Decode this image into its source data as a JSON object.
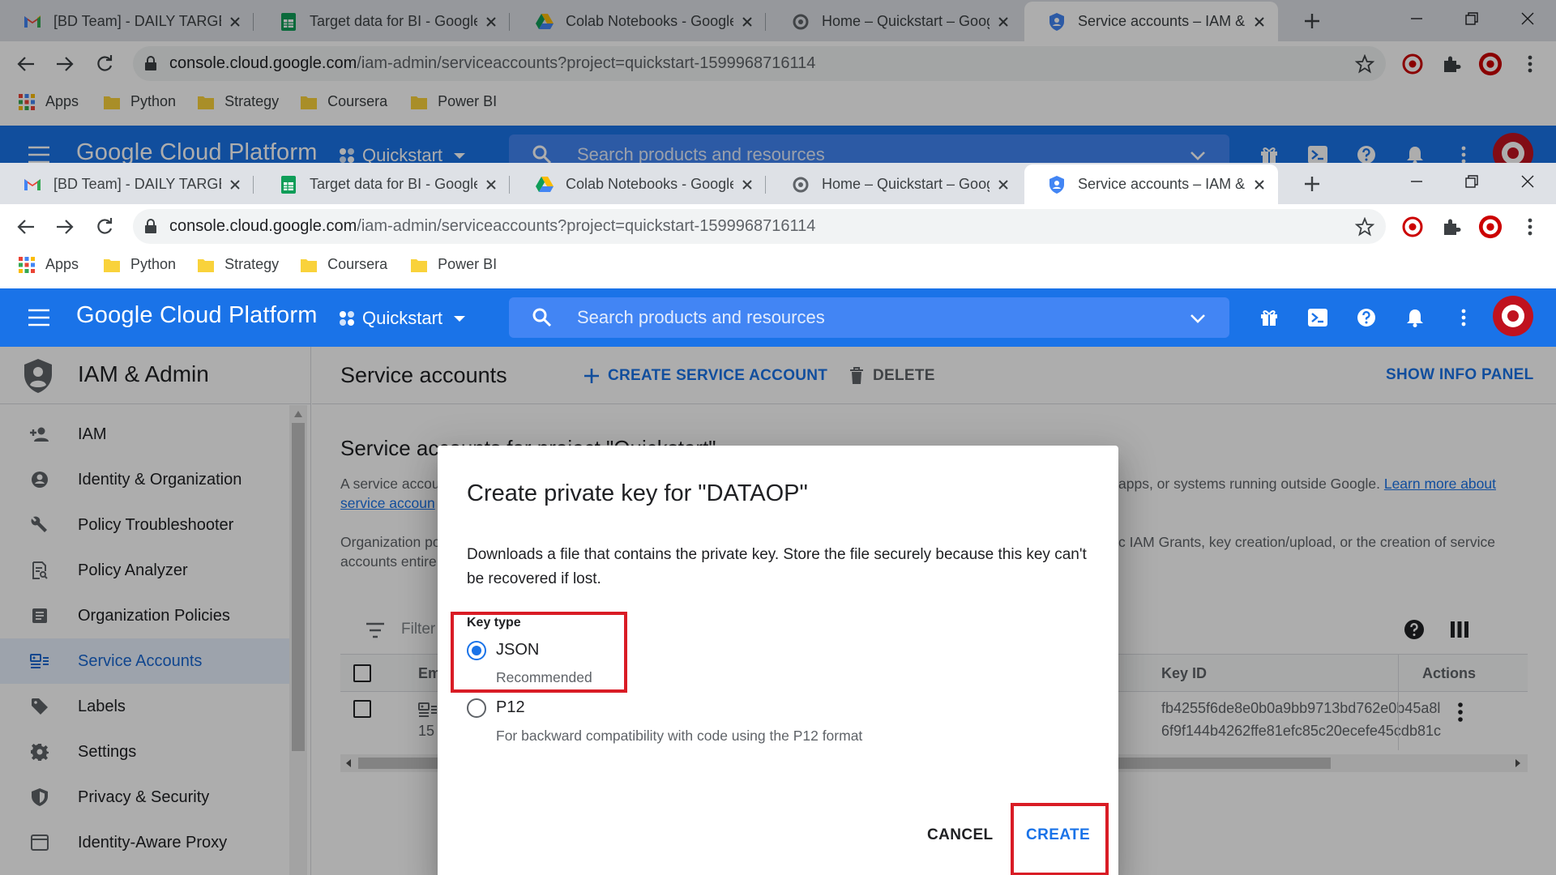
{
  "browser": {
    "tabs": [
      {
        "title": "[BD Team] - DAILY TARGET S",
        "favicon": "gmail-icon"
      },
      {
        "title": "Target data for BI - Google",
        "favicon": "sheets-icon"
      },
      {
        "title": "Colab Notebooks - Google",
        "favicon": "drive-icon"
      },
      {
        "title": "Home – Quickstart – Googl",
        "favicon": "chrome-page-icon"
      },
      {
        "title": "Service accounts – IAM & A",
        "favicon": "gcp-shield-icon"
      }
    ],
    "url_host": "console.cloud.google.com",
    "url_path": "/iam-admin/serviceaccounts?project=quickstart-1599968716114",
    "bookmarks": [
      {
        "label": "Apps",
        "icon": "apps-grid-icon"
      },
      {
        "label": "Python",
        "icon": "folder-icon"
      },
      {
        "label": "Strategy",
        "icon": "folder-icon"
      },
      {
        "label": "Coursera",
        "icon": "folder-icon"
      },
      {
        "label": "Power BI",
        "icon": "folder-icon"
      }
    ]
  },
  "gcp": {
    "title": "Google Cloud Platform",
    "project": "Quickstart",
    "search_placeholder": "Search products and resources",
    "brand_color": "#1a73e8"
  },
  "nav": {
    "title": "IAM & Admin",
    "items": [
      {
        "label": "IAM",
        "icon": "person-add-icon"
      },
      {
        "label": "Identity & Organization",
        "icon": "account-circle-icon"
      },
      {
        "label": "Policy Troubleshooter",
        "icon": "wrench-icon"
      },
      {
        "label": "Policy Analyzer",
        "icon": "policy-doc-icon"
      },
      {
        "label": "Organization Policies",
        "icon": "list-doc-icon"
      },
      {
        "label": "Service Accounts",
        "icon": "service-account-icon",
        "active": true
      },
      {
        "label": "Labels",
        "icon": "label-icon"
      },
      {
        "label": "Settings",
        "icon": "gear-icon"
      },
      {
        "label": "Privacy & Security",
        "icon": "shield-icon"
      },
      {
        "label": "Identity-Aware Proxy",
        "icon": "iap-icon"
      }
    ]
  },
  "main": {
    "title": "Service accounts",
    "create_label": "CREATE SERVICE ACCOUNT",
    "delete_label": "DELETE",
    "info_panel_label": "SHOW INFO PANEL",
    "section_title": "Service accounts for project \"Quickstart\"",
    "desc1_start": "A service accou",
    "desc1_end": "apps, or systems running outside Google.",
    "desc1_link": "Learn more about",
    "desc1_link2": "service accoun",
    "desc2_start": "Organization po",
    "desc2_end": "c IAM Grants, key creation/upload, or the creation of service",
    "desc2_line2": "accounts entire",
    "filter_placeholder": "Filter",
    "columns": {
      "email": "Em",
      "key_id": "Key ID",
      "actions": "Actions"
    },
    "row": {
      "email_fragment": "15",
      "key_id_1": "fb4255f6de8e0b0a9bb9713bd762e0b45a8l",
      "key_id_2": "6f9f144b4262ffe81efc85c20ecefe45cdb81c"
    }
  },
  "dialog": {
    "title": "Create private key for \"DATAOP\"",
    "body": "Downloads a file that contains the private key. Store the file securely because this key can't be recovered if lost.",
    "key_type_label": "Key type",
    "options": [
      {
        "label": "JSON",
        "sub": "Recommended",
        "selected": true
      },
      {
        "label": "P12",
        "sub": "For backward compatibility with code using the P12 format",
        "selected": false
      }
    ],
    "cancel_label": "CANCEL",
    "create_label": "CREATE",
    "highlight_color": "#d91c25"
  }
}
